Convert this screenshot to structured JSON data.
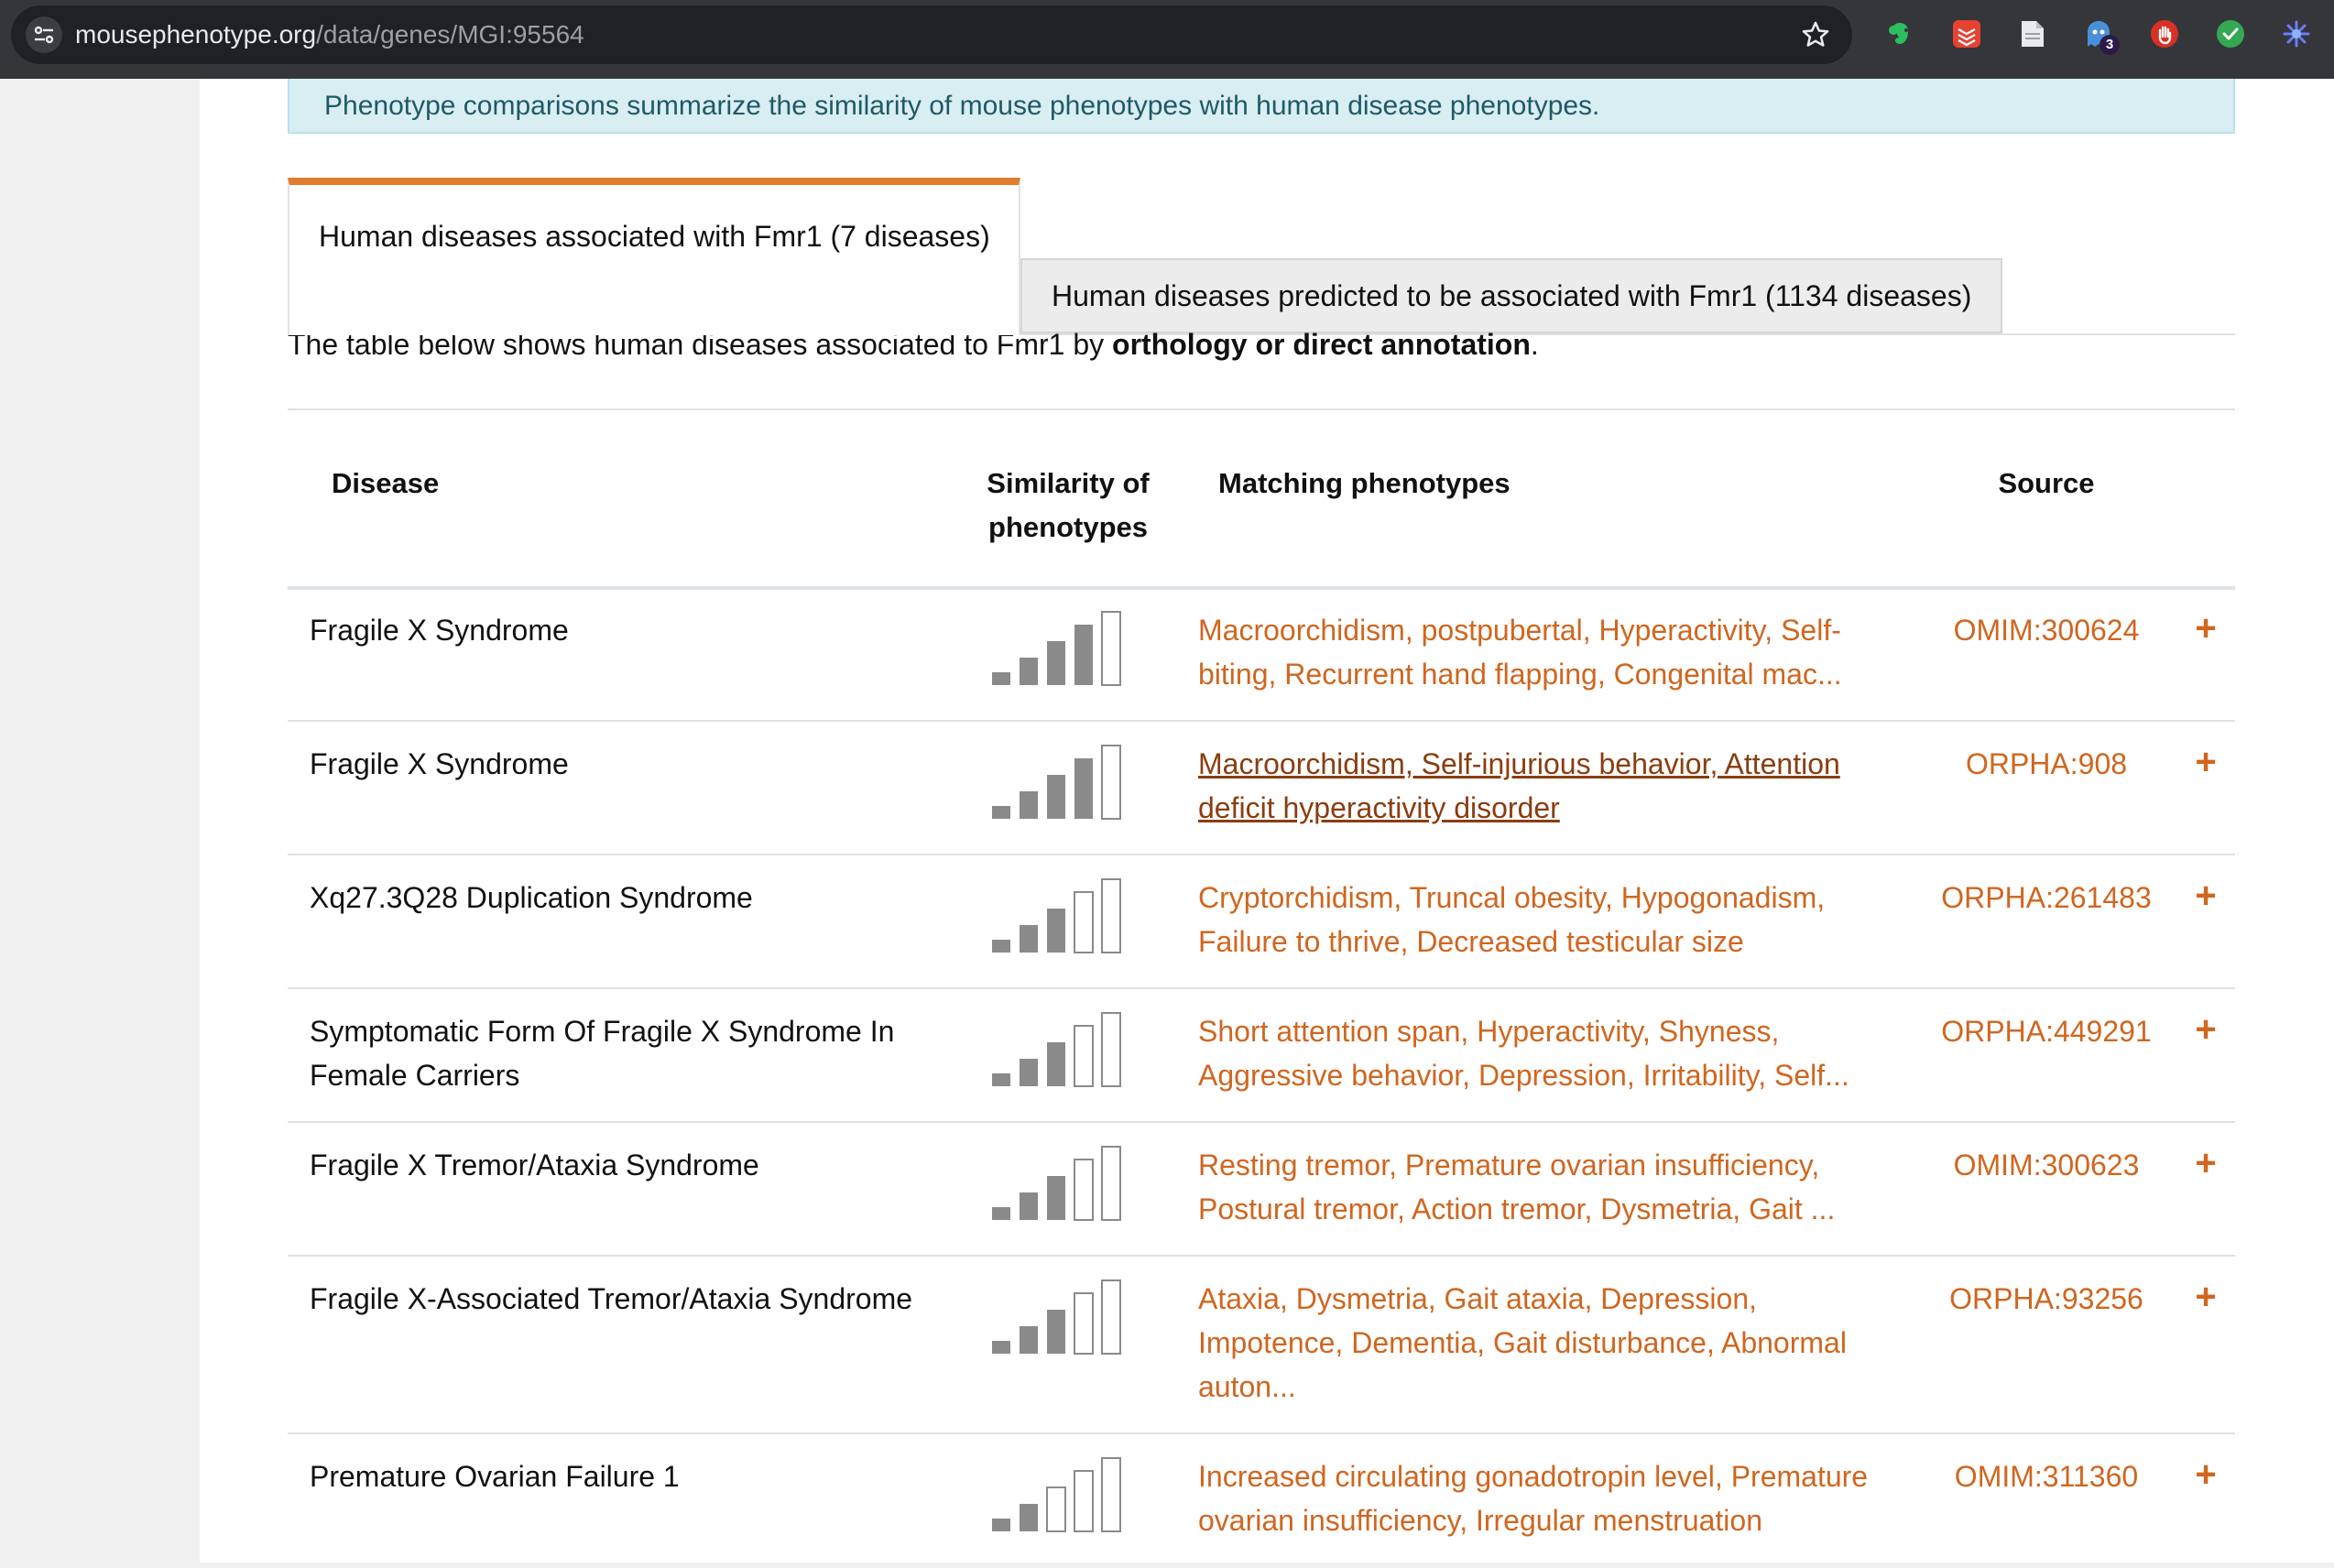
{
  "browser": {
    "url_host": "mousephenotype.org",
    "url_path": "/data/genes/MGI:95564",
    "extensions_badge": "3"
  },
  "banner": {
    "text": "Phenotype comparisons summarize the similarity of mouse phenotypes with human disease phenotypes."
  },
  "tabs": [
    {
      "label": "Human diseases associated with Fmr1 (7 diseases)",
      "active": true
    },
    {
      "label": "Human diseases predicted to be associated with Fmr1 (1134 diseases)",
      "active": false
    }
  ],
  "intro": {
    "text_before": "The table below shows human diseases associated to Fmr1 by ",
    "text_bold": "orthology or direct annotation",
    "text_after": "."
  },
  "table": {
    "headers": {
      "disease": "Disease",
      "similarity": "Similarity of phenotypes",
      "matching": "Matching phenotypes",
      "source": "Source"
    },
    "rows": [
      {
        "disease": "Fragile X Syndrome",
        "similarity_level": 4,
        "phenotypes": "Macroorchidism, postpubertal, Hyperactivity, Self-biting, Recurrent hand flapping, Congenital mac...",
        "source": "OMIM:300624",
        "expand": "+"
      },
      {
        "disease": "Fragile X Syndrome",
        "similarity_level": 4,
        "phenotypes": "Macroorchidism, Self-injurious behavior, Attention deficit hyperactivity disorder",
        "source": "ORPHA:908",
        "expand": "+"
      },
      {
        "disease": "Xq27.3Q28 Duplication Syndrome",
        "similarity_level": 3,
        "phenotypes": "Cryptorchidism, Truncal obesity, Hypogonadism, Failure to thrive, Decreased testicular size",
        "source": "ORPHA:261483",
        "expand": "+"
      },
      {
        "disease": "Symptomatic Form Of Fragile X Syndrome In Female Carriers",
        "similarity_level": 3,
        "phenotypes": "Short attention span, Hyperactivity, Shyness, Aggressive behavior, Depression, Irritability, Self...",
        "source": "ORPHA:449291",
        "expand": "+"
      },
      {
        "disease": "Fragile X Tremor/Ataxia Syndrome",
        "similarity_level": 3,
        "phenotypes": "Resting tremor, Premature ovarian insufficiency, Postural tremor, Action tremor, Dysmetria, Gait ...",
        "source": "OMIM:300623",
        "expand": "+"
      },
      {
        "disease": "Fragile X-Associated Tremor/Ataxia Syndrome",
        "similarity_level": 3,
        "phenotypes": "Ataxia, Dysmetria, Gait ataxia, Depression, Impotence, Dementia, Gait disturbance, Abnormal auton...",
        "source": "ORPHA:93256",
        "expand": "+"
      },
      {
        "disease": "Premature Ovarian Failure 1",
        "similarity_level": 2,
        "phenotypes": "Increased circulating gonadotropin level, Premature ovarian insufficiency, Irregular menstruation",
        "source": "OMIM:311360",
        "expand": "+"
      }
    ]
  },
  "colors": {
    "accent": "#d0661f",
    "tab_active_border": "#e27d2f",
    "banner_bg": "#d9eef3",
    "bar_filled": "#8a8a8a"
  }
}
